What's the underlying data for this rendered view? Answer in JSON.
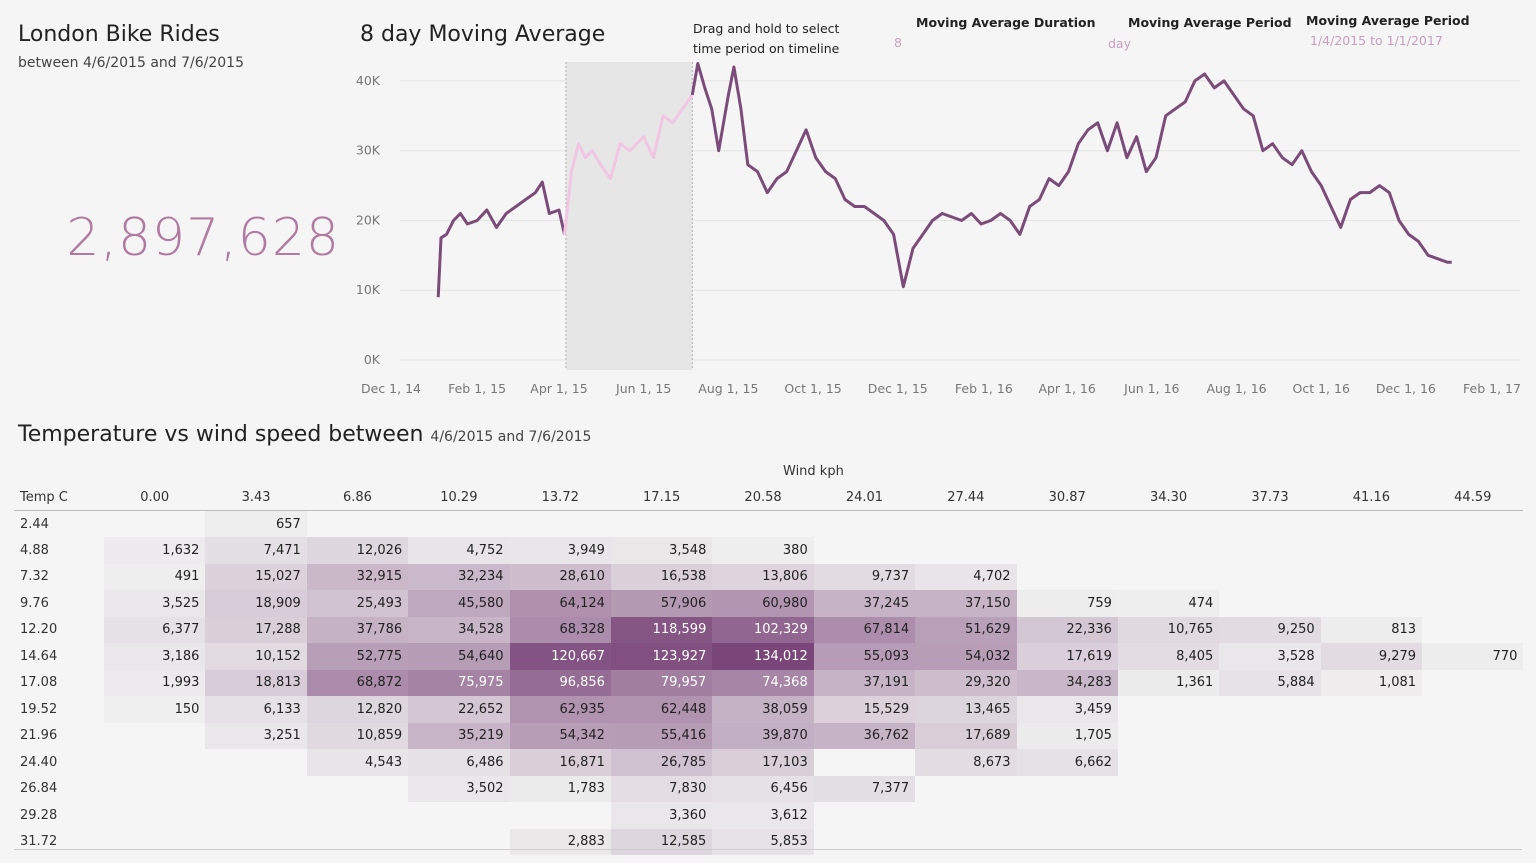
{
  "header": {
    "title": "London Bike Rides",
    "subtitle": "between 4/6/2015 and 7/6/2015",
    "total_rides": "2,897,628"
  },
  "moving_average": {
    "title": "8 day Moving Average",
    "instruction_line1": "Drag and hold to select",
    "instruction_line2": "time period on timeline",
    "duration_label": "Moving Average Duration",
    "duration_value": "8",
    "period_label": "Moving Average Period",
    "period_value": "day",
    "range_label": "Moving Average Period",
    "range_value": "1/4/2015 to 1/1/2017"
  },
  "chart_data": [
    {
      "type": "line",
      "ylim": [
        0,
        43000
      ],
      "y_ticks": [
        "0K",
        "10K",
        "20K",
        "30K",
        "40K"
      ],
      "x_ticks": [
        "Dec 1, 14",
        "Feb 1, 15",
        "Apr 1, 15",
        "Jun 1, 15",
        "Aug 1, 15",
        "Oct 1, 15",
        "Dec 1, 15",
        "Feb 1, 16",
        "Apr 1, 16",
        "Jun 1, 16",
        "Aug 1, 16",
        "Oct 1, 16",
        "Dec 1, 16",
        "Feb 1, 17"
      ],
      "selection": [
        "2015-04-06",
        "2015-07-06"
      ],
      "colors": {
        "line": "#7b4b7a",
        "selected": "#f1c6e2",
        "band": "#e6e6e6"
      },
      "series": [
        {
          "x": [
            "2015-01-04",
            "2015-01-06",
            "2015-01-10",
            "2015-01-15",
            "2015-01-20",
            "2015-01-25",
            "2015-02-01",
            "2015-02-08",
            "2015-02-15",
            "2015-02-22",
            "2015-03-01",
            "2015-03-08",
            "2015-03-15",
            "2015-03-20",
            "2015-03-25",
            "2015-04-01",
            "2015-04-05",
            "2015-04-10",
            "2015-04-15",
            "2015-04-20",
            "2015-04-25",
            "2015-05-01",
            "2015-05-08",
            "2015-05-15",
            "2015-05-22",
            "2015-06-01",
            "2015-06-08",
            "2015-06-15",
            "2015-06-22",
            "2015-06-29",
            "2015-07-06",
            "2015-07-10",
            "2015-07-15",
            "2015-07-20",
            "2015-07-25",
            "2015-08-01",
            "2015-08-05",
            "2015-08-10",
            "2015-08-15",
            "2015-08-22",
            "2015-08-29",
            "2015-09-05",
            "2015-09-12",
            "2015-09-19",
            "2015-09-26",
            "2015-10-03",
            "2015-10-10",
            "2015-10-17",
            "2015-10-24",
            "2015-10-31",
            "2015-11-07",
            "2015-11-14",
            "2015-11-21",
            "2015-11-28",
            "2015-12-05",
            "2015-12-12",
            "2015-12-19",
            "2015-12-26",
            "2016-01-02",
            "2016-01-09",
            "2016-01-16",
            "2016-01-23",
            "2016-01-30",
            "2016-02-06",
            "2016-02-13",
            "2016-02-20",
            "2016-02-27",
            "2016-03-05",
            "2016-03-12",
            "2016-03-19",
            "2016-03-26",
            "2016-04-02",
            "2016-04-09",
            "2016-04-16",
            "2016-04-23",
            "2016-04-30",
            "2016-05-07",
            "2016-05-14",
            "2016-05-21",
            "2016-05-28",
            "2016-06-04",
            "2016-06-11",
            "2016-06-18",
            "2016-06-25",
            "2016-07-02",
            "2016-07-09",
            "2016-07-16",
            "2016-07-23",
            "2016-07-30",
            "2016-08-06",
            "2016-08-13",
            "2016-08-20",
            "2016-08-27",
            "2016-09-03",
            "2016-09-10",
            "2016-09-17",
            "2016-09-24",
            "2016-10-01",
            "2016-10-08",
            "2016-10-15",
            "2016-10-22",
            "2016-10-29",
            "2016-11-05",
            "2016-11-12",
            "2016-11-19",
            "2016-11-26",
            "2016-12-03",
            "2016-12-10",
            "2016-12-17",
            "2016-12-24",
            "2016-12-31",
            "2017-01-03"
          ],
          "values": [
            9000,
            17500,
            18000,
            20000,
            21000,
            19500,
            20000,
            21500,
            19000,
            21000,
            22000,
            23000,
            24000,
            25500,
            21000,
            21500,
            18000,
            27000,
            31000,
            29000,
            30000,
            28000,
            26000,
            31000,
            30000,
            32000,
            29000,
            35000,
            34000,
            36000,
            38000,
            42500,
            39000,
            36000,
            30000,
            38000,
            42000,
            36000,
            28000,
            27000,
            24000,
            26000,
            27000,
            30000,
            33000,
            29000,
            27000,
            26000,
            23000,
            22000,
            22000,
            21000,
            20000,
            18000,
            10500,
            16000,
            18000,
            20000,
            21000,
            20500,
            20000,
            21000,
            19500,
            20000,
            21000,
            20000,
            18000,
            22000,
            23000,
            26000,
            25000,
            27000,
            31000,
            33000,
            34000,
            30000,
            34000,
            29000,
            32000,
            27000,
            29000,
            35000,
            36000,
            37000,
            40000,
            41000,
            39000,
            40000,
            38000,
            36000,
            35000,
            30000,
            31000,
            29000,
            28000,
            30000,
            27000,
            25000,
            22000,
            19000,
            23000,
            24000,
            24000,
            25000,
            24000,
            20000,
            18000,
            17000,
            15000,
            14500,
            14000,
            14000
          ]
        }
      ]
    },
    {
      "type": "heatmap",
      "title": "Temperature vs wind speed between",
      "subtitle": "4/6/2015 and 7/6/2015",
      "x_title": "Wind kph",
      "y_title": "Temp C",
      "x": [
        "0.00",
        "3.43",
        "6.86",
        "10.29",
        "13.72",
        "17.15",
        "20.58",
        "24.01",
        "27.44",
        "30.87",
        "34.30",
        "37.73",
        "41.16",
        "44.59"
      ],
      "y": [
        "2.44",
        "4.88",
        "7.32",
        "9.76",
        "12.20",
        "14.64",
        "17.08",
        "19.52",
        "21.96",
        "24.40",
        "26.84",
        "29.28",
        "31.72"
      ],
      "max_value": 134012,
      "values": [
        [
          null,
          657,
          null,
          null,
          null,
          null,
          null,
          null,
          null,
          null,
          null,
          null,
          null,
          null
        ],
        [
          1632,
          7471,
          12026,
          4752,
          3949,
          3548,
          380,
          null,
          null,
          null,
          null,
          null,
          null,
          null
        ],
        [
          491,
          15027,
          32915,
          32234,
          28610,
          16538,
          13806,
          9737,
          4702,
          null,
          null,
          null,
          null,
          null
        ],
        [
          3525,
          18909,
          25493,
          45580,
          64124,
          57906,
          60980,
          37245,
          37150,
          759,
          474,
          null,
          null,
          null
        ],
        [
          6377,
          17288,
          37786,
          34528,
          68328,
          118599,
          102329,
          67814,
          51629,
          22336,
          10765,
          9250,
          813,
          null
        ],
        [
          3186,
          10152,
          52775,
          54640,
          120667,
          123927,
          134012,
          55093,
          54032,
          17619,
          8405,
          3528,
          9279,
          770
        ],
        [
          1993,
          18813,
          68872,
          75975,
          96856,
          79957,
          74368,
          37191,
          29320,
          34283,
          1361,
          5884,
          1081,
          null
        ],
        [
          150,
          6133,
          12820,
          22652,
          62935,
          62448,
          38059,
          15529,
          13465,
          3459,
          null,
          null,
          null,
          null
        ],
        [
          null,
          3251,
          10859,
          35219,
          54342,
          55416,
          39870,
          36762,
          17689,
          1705,
          null,
          null,
          null,
          null
        ],
        [
          null,
          null,
          4543,
          6486,
          16871,
          26785,
          17103,
          null,
          8673,
          6662,
          null,
          null,
          null,
          null
        ],
        [
          null,
          null,
          null,
          3502,
          1783,
          7830,
          6456,
          7377,
          null,
          null,
          null,
          null,
          null,
          null
        ],
        [
          null,
          null,
          null,
          null,
          null,
          3360,
          3612,
          null,
          null,
          null,
          null,
          null,
          null,
          null
        ],
        [
          null,
          null,
          null,
          null,
          2883,
          12585,
          5853,
          null,
          null,
          null,
          null,
          null,
          null,
          null
        ]
      ]
    }
  ]
}
